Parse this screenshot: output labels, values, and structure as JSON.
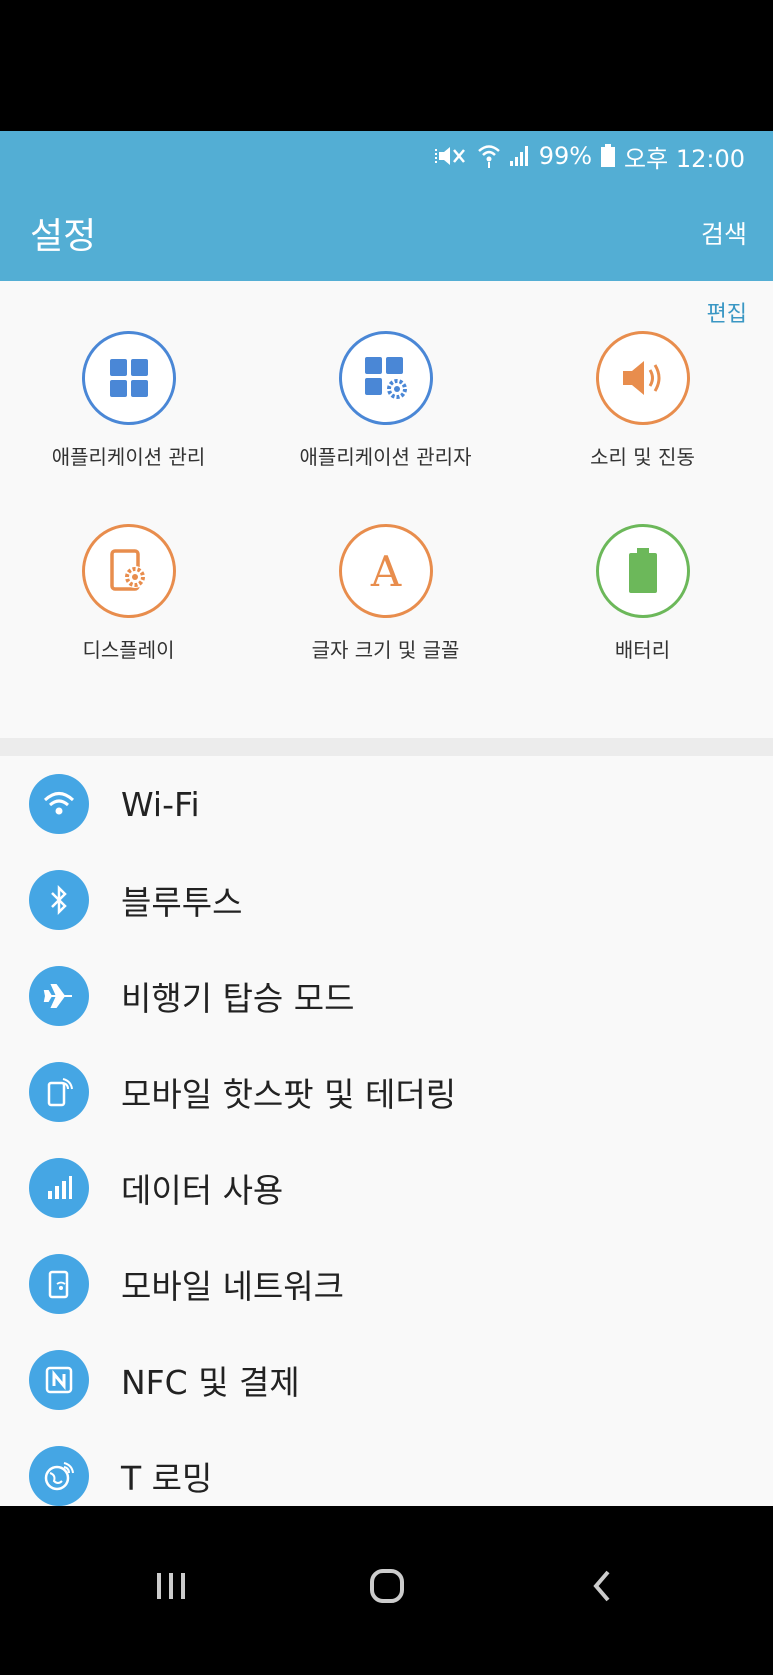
{
  "status": {
    "battery": "99%",
    "time": "오후 12:00"
  },
  "appbar": {
    "title": "설정",
    "search": "검색"
  },
  "edit_label": "편집",
  "quick": [
    {
      "label": "애플리케이션 관리",
      "icon": "apps-grid-icon",
      "color": "#4a87d6"
    },
    {
      "label": "애플리케이션 관리자",
      "icon": "app-manager-gear-icon",
      "color": "#4a87d6"
    },
    {
      "label": "소리 및 진동",
      "icon": "speaker-icon",
      "color": "#e88d4d"
    },
    {
      "label": "디스플레이",
      "icon": "display-gear-icon",
      "color": "#e88d4d"
    },
    {
      "label": "글자 크기 및 글꼴",
      "icon": "font-a-icon",
      "color": "#e88d4d"
    },
    {
      "label": "배터리",
      "icon": "battery-icon",
      "color": "#6cb85a"
    }
  ],
  "settings": [
    {
      "label": "Wi-Fi",
      "icon": "wifi-icon"
    },
    {
      "label": "블루투스",
      "icon": "bluetooth-icon"
    },
    {
      "label": "비행기 탑승 모드",
      "icon": "airplane-icon"
    },
    {
      "label": "모바일 핫스팟 및 테더링",
      "icon": "hotspot-icon"
    },
    {
      "label": "데이터 사용",
      "icon": "data-usage-icon"
    },
    {
      "label": "모바일 네트워크",
      "icon": "mobile-network-icon"
    },
    {
      "label": "NFC 및 결제",
      "icon": "nfc-icon"
    },
    {
      "label": "T 로밍",
      "icon": "globe-roaming-icon"
    }
  ],
  "colors": {
    "appbar": "#53aed4",
    "list_icon": "#45a6e4"
  }
}
